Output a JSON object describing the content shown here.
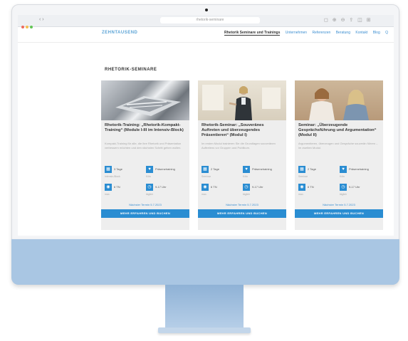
{
  "browser": {
    "url": "rhetorik-seminare",
    "nav_arrows": "‹ ›",
    "tool_icons": "◻ ⊕ ⊖ ⇪ ◫ ⊞",
    "traffic_colors": [
      "#ed6a5e",
      "#f5bf4f",
      "#61c554"
    ]
  },
  "site": {
    "logo": "ZEHNTAUSEND",
    "nav": [
      "Rhetorik Seminare und Trainings",
      "Unternehmen",
      "Referenzen",
      "Beratung",
      "Kontakt",
      "Blog",
      "Q"
    ]
  },
  "section_title": "RHETORIK-SEMINARE",
  "cards": [
    {
      "title": "Rhetorik-Training: „Rhetorik-Kompakt-Training“ (Module I-III im Intensiv-Block)",
      "desc": "Kompakt-Training für alle, die ihre Rhetorik und Präsentation verbessern möchten und den nächsten Schritt gehen wollen.",
      "meta": [
        {
          "icon": "calendar-icon",
          "glyph": "▦",
          "label": "3 Tage",
          "sub": "Intensiv-Block"
        },
        {
          "icon": "heart-icon",
          "glyph": "♥",
          "label": "Präsenztraining",
          "sub": "Köln"
        },
        {
          "icon": "users-icon",
          "glyph": "◉",
          "label": "6 TN",
          "sub": "max."
        },
        {
          "icon": "clock-icon",
          "glyph": "◷",
          "label": "9-17 Uhr",
          "sub": "täglich"
        }
      ],
      "link": "Nächster Termin 5.7.2023",
      "cta": "MEHR ERFAHREN UND BUCHEN"
    },
    {
      "title": "Rhetorik-Seminar: „Souveränes Auftreten und überzeugendes Präsentieren“ (Modul I)",
      "desc": "Im ersten Modul trainieren Sie die Grundlagen souveränen Auftretens vor Gruppen und Publikum.",
      "meta": [
        {
          "icon": "calendar-icon",
          "glyph": "▦",
          "label": "2 Tage",
          "sub": "Seminar"
        },
        {
          "icon": "heart-icon",
          "glyph": "♥",
          "label": "Präsenztraining",
          "sub": "Köln"
        },
        {
          "icon": "users-icon",
          "glyph": "◉",
          "label": "6 TN",
          "sub": "max."
        },
        {
          "icon": "clock-icon",
          "glyph": "◷",
          "label": "9-17 Uhr",
          "sub": "täglich"
        }
      ],
      "link": "Nächster Termin 5.7.2023",
      "cta": "MEHR ERFAHREN UND BUCHEN"
    },
    {
      "title": "Seminar: „Überzeugende Gesprächsführung und Argumentation“ (Modul II)",
      "desc": "Argumentieren, überzeugen und Gespräche souverän führen – im zweiten Modul.",
      "meta": [
        {
          "icon": "calendar-icon",
          "glyph": "▦",
          "label": "2 Tage",
          "sub": "Seminar"
        },
        {
          "icon": "heart-icon",
          "glyph": "♥",
          "label": "Präsenztraining",
          "sub": "Köln"
        },
        {
          "icon": "users-icon",
          "glyph": "◉",
          "label": "6 TN",
          "sub": "max."
        },
        {
          "icon": "clock-icon",
          "glyph": "◷",
          "label": "9-17 Uhr",
          "sub": "täglich"
        }
      ],
      "link": "Nächster Termin 5.7.2023",
      "cta": "MEHR ERFAHREN UND BUCHEN"
    }
  ],
  "colors": {
    "accent": "#2a8dd2",
    "link": "#3d8fd1",
    "monitor_chin": "#a9c6e3",
    "card_bg": "#eeeeee"
  }
}
